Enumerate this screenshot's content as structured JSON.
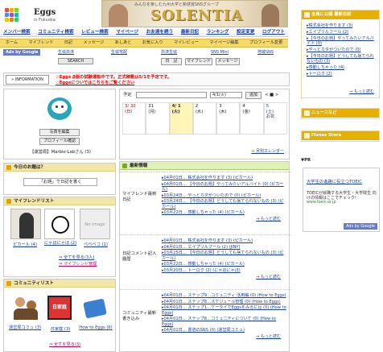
{
  "logo": {
    "title": "Eggs",
    "sub": "in Fukuoka"
  },
  "banner": {
    "caption": "みんなを楽しむ九州大学と新感覚SNSグループ",
    "word": "SOLENTIA"
  },
  "nav": [
    "メンバー検索",
    "コミュニティ検索",
    "レビュー検索",
    "マイページ",
    "お友達を誘う",
    "最新日記",
    "ランキング",
    "設定変更",
    "ログアウト"
  ],
  "subnav": [
    "ホーム",
    "マイフレンド",
    "日記",
    "メッセージ",
    "あしあと",
    "お気に入り",
    "マイレビュー",
    "マイページ編集",
    "プロフィール変更"
  ],
  "ads": {
    "label": "Ads by Google",
    "links": [
      "生協共済",
      "生協宅配",
      "共済生協",
      "SNS Mini",
      "地域SNS"
    ],
    "search": "SEARCH",
    "diary": "日　記",
    "friend": "マイフレンド",
    "msg": "メッセージ"
  },
  "info": {
    "label": "» INFORMATION",
    "l1": "☆Eggs β版の試験運転中です。正式稼動は5/1を予定です。",
    "l2": "☆Eggsについてはこちらをご覧ください"
  },
  "profile": {
    "photo_btn": "写真を編集",
    "prof_btn": "プロフィール確認",
    "name": "【運営局】Marble-Labさん (3)"
  },
  "calendar": {
    "yotei": "予定",
    "date": "4/1(火)",
    "add": "追加",
    "nav": "< ■ >",
    "days": [
      {
        "d": "3/ 30",
        "w": "(日)"
      },
      {
        "d": "31",
        "w": "(月)"
      },
      {
        "d": "4/ 1",
        "w": "(火)"
      },
      {
        "d": "2",
        "w": "(水)"
      },
      {
        "d": "3",
        "w": "(木)"
      },
      {
        "d": "4",
        "w": "(金)"
      },
      {
        "d": "5",
        "w": "(土)"
      }
    ],
    "sat_note": "お花",
    "more": "⇒ 月別カレンダー"
  },
  "today": {
    "title": "今日のお題は？",
    "box": "「お題」で日記を書く"
  },
  "friends": {
    "title": "マイフレンドリスト",
    "items": [
      {
        "name": "ピカール (4)"
      },
      {
        "name": "にゃほにゃほ (2)"
      },
      {
        "name": "ベベベコ (1)"
      }
    ],
    "noimage": "No image",
    "all": "⇒ 全てを見る(3人)",
    "manage": "⇒ マイフレンド管理"
  },
  "comm": {
    "title": "コミュニティリスト",
    "items": [
      {
        "name": "運営局コミュ (3)"
      },
      {
        "name": "日家庭 (3)"
      },
      {
        "name": "How to Eggs (6)"
      }
    ],
    "all": "⇒ 全てを見る(3)"
  },
  "news": {
    "title": "最新情報",
    "diary": {
      "cat": "マイフレンド最新日記",
      "items": [
        "▸04月01日… 株式会社を作ります (3) (ピカール)",
        "▸04月01日… 【今日のお題】やってみたいアルバイト (0) (ピカール)",
        "▸03月24日… やっとカタがついたので (0) (ピカール)",
        "▸03月24日… 【今日のお題】どうしても捨てられないもの (3) (ピカール)",
        "▸03月22日… 感動しちゃった (4) (ピカール)"
      ],
      "more": "⇒ もっと読む"
    },
    "comment": {
      "cat": "日記コメント記入履歴",
      "items": [
        "▸04月01日… 株式会社を作ります (3) (ピカール)",
        "▸04月01日… エイプリルフール (2) (JINY)",
        "▸03月25日… 【今日のお題】どうしても捨てられないもの (3) (ピカール)",
        "▸03月22日… 感動しちゃった (4) (ピカール)",
        "▸03月20日… トーロク (2) (にゃほにゃほ)"
      ],
      "more": "⇒ もっと読む"
    },
    "community": {
      "cat": "コミュニティ最新書き込み",
      "items": [
        "▸04月01日… ステップ9…コミュニティ 活用編 (0) (How to Eggs)",
        "▸04月01日… ステップ8…スケジュール管理 (0) (How to Eggs)",
        "▸04月01日… ステップ1…ケータイでEggsをみるには (0) (How to Eggs)",
        "▸04月01日… ステップ8…コミュニティについて (0) (How to Eggs)",
        "▸04月01日… 書道のSNS (0) (運営局コミュ)"
      ],
      "more": "⇒ もっと読む"
    }
  },
  "rank": {
    "title": "全員に公開 最新日記",
    "items": [
      "▸株式会社を作ります (3)",
      "▸エイプリルフール (2)",
      "▸【今日のお題】やってみたいアルバイト (0)",
      "▸やっとカタがついたので (0)",
      "▸【今日のお題】どうしても捨てられないもの (3)",
      "▸感動しちゃった (4)",
      "▸トーロク (2)"
    ],
    "more": "⇒ もっと読む"
  },
  "rnews": {
    "title": "ニュースなど"
  },
  "rstore": {
    "title": "iTunes Store"
  },
  "pr": {
    "label": "▼PR",
    "ad_title": "大学生の進路に役立つTOEIC",
    "ad_body": "TOEICが就職する大学生・大学院生 向けの情報はここでチェック!",
    "ad_url": "www.toeic.or.jp",
    "ad_label": "Ads by Google"
  },
  "colors": {
    "nav_link": "#1a3fae",
    "subnav_bg": "#f6d96b",
    "right_header": "#e6b000",
    "info_red": "#e00000"
  }
}
